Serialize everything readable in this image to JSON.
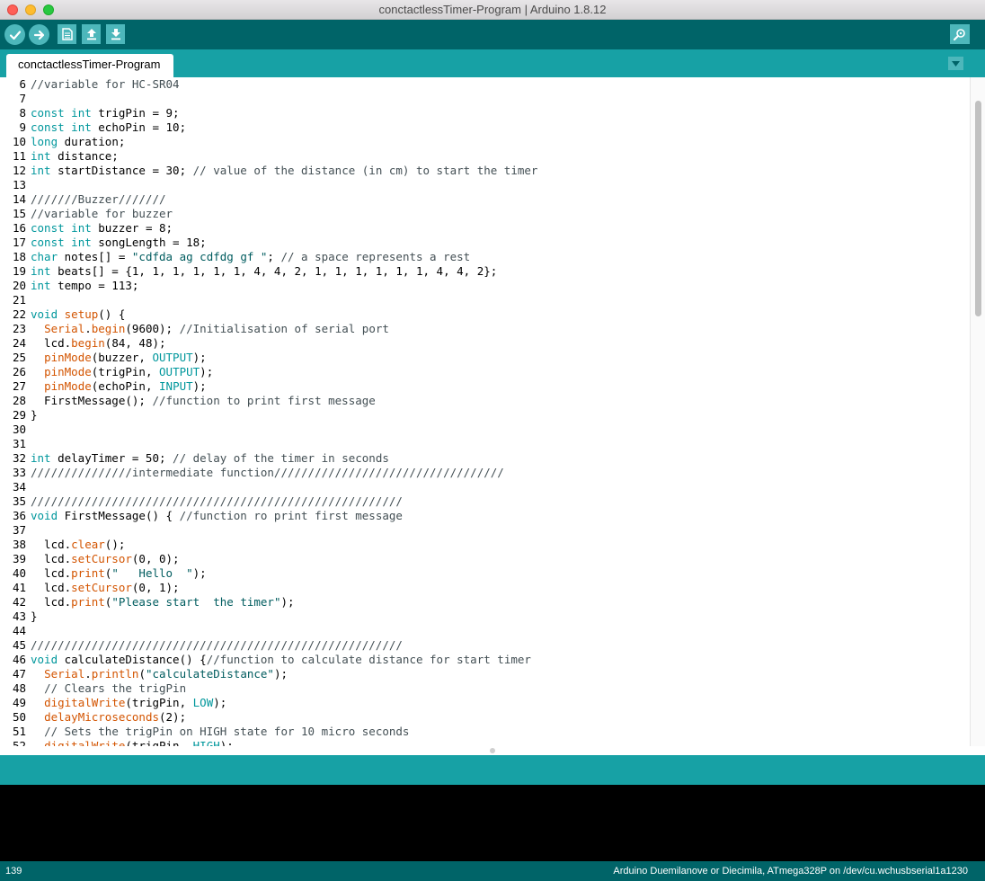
{
  "window": {
    "title": "conctactlessTimer-Program | Arduino 1.8.12"
  },
  "toolbar": {
    "buttons": [
      {
        "name": "verify",
        "icon": "checkmark-icon"
      },
      {
        "name": "upload",
        "icon": "arrow-right-icon"
      },
      {
        "name": "new",
        "icon": "new-file-icon"
      },
      {
        "name": "open",
        "icon": "arrow-up-icon"
      },
      {
        "name": "save",
        "icon": "arrow-down-icon"
      },
      {
        "name": "serial-monitor",
        "icon": "magnifier-icon"
      }
    ]
  },
  "tabs": [
    {
      "label": "conctactlessTimer-Program",
      "active": true
    }
  ],
  "editor": {
    "lines": [
      {
        "n": "6",
        "code": "//variable for HC-SR04"
      },
      {
        "n": "7",
        "code": ""
      },
      {
        "n": "8",
        "code": "const int trigPin = 9;"
      },
      {
        "n": "9",
        "code": "const int echoPin = 10;"
      },
      {
        "n": "10",
        "code": "long duration;"
      },
      {
        "n": "11",
        "code": "int distance;"
      },
      {
        "n": "12",
        "code": "int startDistance = 30; // value of the distance (in cm) to start the timer"
      },
      {
        "n": "13",
        "code": ""
      },
      {
        "n": "14",
        "code": "///////Buzzer///////"
      },
      {
        "n": "15",
        "code": "//variable for buzzer"
      },
      {
        "n": "16",
        "code": "const int buzzer = 8;"
      },
      {
        "n": "17",
        "code": "const int songLength = 18;"
      },
      {
        "n": "18",
        "code": "char notes[] = \"cdfda ag cdfdg gf \"; // a space represents a rest"
      },
      {
        "n": "19",
        "code": "int beats[] = {1, 1, 1, 1, 1, 1, 4, 4, 2, 1, 1, 1, 1, 1, 1, 4, 4, 2};"
      },
      {
        "n": "20",
        "code": "int tempo = 113;"
      },
      {
        "n": "21",
        "code": ""
      },
      {
        "n": "22",
        "code": "void setup() {"
      },
      {
        "n": "23",
        "code": "  Serial.begin(9600); //Initialisation of serial port"
      },
      {
        "n": "24",
        "code": "  lcd.begin(84, 48);"
      },
      {
        "n": "25",
        "code": "  pinMode(buzzer, OUTPUT);"
      },
      {
        "n": "26",
        "code": "  pinMode(trigPin, OUTPUT);"
      },
      {
        "n": "27",
        "code": "  pinMode(echoPin, INPUT);"
      },
      {
        "n": "28",
        "code": "  FirstMessage(); //function to print first message"
      },
      {
        "n": "29",
        "code": "}"
      },
      {
        "n": "30",
        "code": ""
      },
      {
        "n": "31",
        "code": ""
      },
      {
        "n": "32",
        "code": "int delayTimer = 50; // delay of the timer in seconds"
      },
      {
        "n": "33",
        "code": "///////////////intermediate function//////////////////////////////////"
      },
      {
        "n": "34",
        "code": ""
      },
      {
        "n": "35",
        "code": "///////////////////////////////////////////////////////"
      },
      {
        "n": "36",
        "code": "void FirstMessage() { //function ro print first message"
      },
      {
        "n": "37",
        "code": ""
      },
      {
        "n": "38",
        "code": "  lcd.clear();"
      },
      {
        "n": "39",
        "code": "  lcd.setCursor(0, 0);"
      },
      {
        "n": "40",
        "code": "  lcd.print(\"   Hello  \");"
      },
      {
        "n": "41",
        "code": "  lcd.setCursor(0, 1);"
      },
      {
        "n": "42",
        "code": "  lcd.print(\"Please start  the timer\");"
      },
      {
        "n": "43",
        "code": "}"
      },
      {
        "n": "44",
        "code": ""
      },
      {
        "n": "45",
        "code": "///////////////////////////////////////////////////////"
      },
      {
        "n": "46",
        "code": "void calculateDistance() {//function to calculate distance for start timer"
      },
      {
        "n": "47",
        "code": "  Serial.println(\"calculateDistance\");"
      },
      {
        "n": "48",
        "code": "  // Clears the trigPin"
      },
      {
        "n": "49",
        "code": "  digitalWrite(trigPin, LOW);"
      },
      {
        "n": "50",
        "code": "  delayMicroseconds(2);"
      },
      {
        "n": "51",
        "code": "  // Sets the trigPin on HIGH state for 10 micro seconds"
      },
      {
        "n": "52",
        "code": "  digitalWrite(trigPin, HIGH);"
      }
    ]
  },
  "status": {
    "line": "139",
    "board": "Arduino Duemilanove or Diecimila, ATmega328P on /dev/cu.wchusbserial1a1230"
  },
  "colors": {
    "toolbar": "#006468",
    "tabbar": "#17a1a5",
    "button": "#4db7bb",
    "keyword": "#00979c",
    "function": "#d35400",
    "comment": "#434f54"
  }
}
